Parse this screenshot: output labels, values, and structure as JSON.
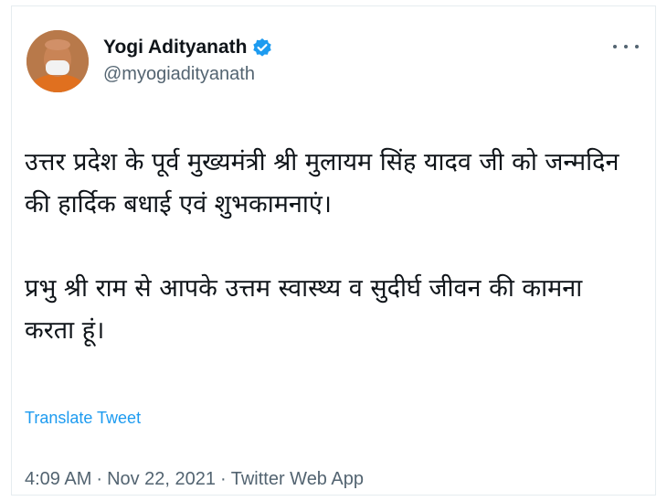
{
  "tweet": {
    "author": {
      "display_name": "Yogi Adityanath",
      "handle": "@myogiadityanath",
      "verified_icon": "verified-badge-icon",
      "avatar_icon": "avatar"
    },
    "more_icon": "more-options-icon",
    "paragraphs": [
      "उत्तर प्रदेश के पूर्व मुख्यमंत्री श्री मुलायम सिंह यादव जी को जन्मदिन की हार्दिक बधाई एवं शुभकामनाएं।",
      "प्रभु श्री राम से आपके उत्तम स्वास्थ्य व सुदीर्घ जीवन की कामना करता हूं।"
    ],
    "translate_label": "Translate Tweet",
    "time": "4:09 AM",
    "separator": "·",
    "date": "Nov 22, 2021",
    "source": "Twitter Web App"
  },
  "colors": {
    "text": "#0f1419",
    "secondary": "#536471",
    "accent": "#1d9bf0",
    "border": "#e6ecf0"
  }
}
